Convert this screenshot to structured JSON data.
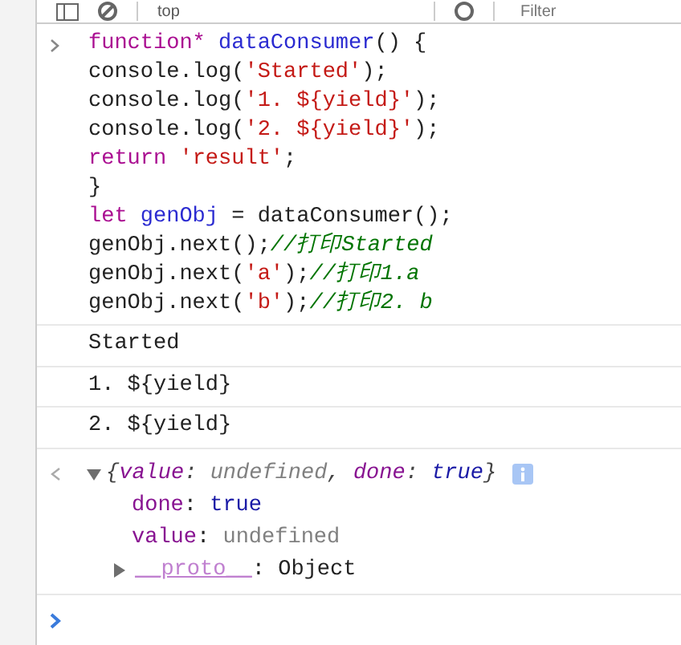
{
  "toolbar": {
    "context": "top",
    "filter": {
      "placeholder": "Filter"
    }
  },
  "input": {
    "lines": [
      [
        {
          "kind": "keyword",
          "text": "function* "
        },
        {
          "kind": "def",
          "text": "dataConsumer"
        },
        {
          "kind": "plain",
          "text": "() {"
        }
      ],
      [
        {
          "kind": "plain",
          "text": "console.log("
        },
        {
          "kind": "string",
          "text": "'Started'"
        },
        {
          "kind": "plain",
          "text": ");"
        }
      ],
      [
        {
          "kind": "plain",
          "text": "console.log("
        },
        {
          "kind": "string",
          "text": "'1. ${yield}'"
        },
        {
          "kind": "plain",
          "text": ");"
        }
      ],
      [
        {
          "kind": "plain",
          "text": "console.log("
        },
        {
          "kind": "string",
          "text": "'2. ${yield}'"
        },
        {
          "kind": "plain",
          "text": ");"
        }
      ],
      [
        {
          "kind": "keyword",
          "text": "return "
        },
        {
          "kind": "string",
          "text": "'result'"
        },
        {
          "kind": "plain",
          "text": ";"
        }
      ],
      [
        {
          "kind": "plain",
          "text": "}"
        }
      ],
      [
        {
          "kind": "keyword",
          "text": "let "
        },
        {
          "kind": "def",
          "text": "genObj"
        },
        {
          "kind": "plain",
          "text": " = dataConsumer();"
        }
      ],
      [
        {
          "kind": "plain",
          "text": "genObj.next();"
        },
        {
          "kind": "comment",
          "text": "//打印Started"
        }
      ],
      [
        {
          "kind": "plain",
          "text": "genObj.next("
        },
        {
          "kind": "string",
          "text": "'a'"
        },
        {
          "kind": "plain",
          "text": ");"
        },
        {
          "kind": "comment",
          "text": "//打印1.a"
        }
      ],
      [
        {
          "kind": "plain",
          "text": "genObj.next("
        },
        {
          "kind": "string",
          "text": "'b'"
        },
        {
          "kind": "plain",
          "text": ");"
        },
        {
          "kind": "comment",
          "text": "//打印2. b"
        }
      ]
    ]
  },
  "logs": [
    "Started",
    "1. ${yield}",
    "2. ${yield}"
  ],
  "result": {
    "expanded": true,
    "summary": [
      {
        "kind": "punct",
        "text": "{"
      },
      {
        "kind": "key",
        "text": "value"
      },
      {
        "kind": "punct",
        "text": ": "
      },
      {
        "kind": "undefined",
        "text": "undefined"
      },
      {
        "kind": "punct",
        "text": ", "
      },
      {
        "kind": "key",
        "text": "done"
      },
      {
        "kind": "punct",
        "text": ": "
      },
      {
        "kind": "boolean",
        "text": "true"
      },
      {
        "kind": "punct",
        "text": "}"
      }
    ],
    "properties": [
      [
        {
          "kind": "key",
          "text": "done"
        },
        {
          "kind": "punct",
          "text": ": "
        },
        {
          "kind": "boolean",
          "text": "true"
        }
      ],
      [
        {
          "kind": "key",
          "text": "value"
        },
        {
          "kind": "punct",
          "text": ": "
        },
        {
          "kind": "undefined",
          "text": "undefined"
        }
      ]
    ],
    "proto": {
      "expanded": false,
      "text": [
        {
          "kind": "proto",
          "text": "__proto__"
        },
        {
          "kind": "punct",
          "text": ": Object"
        }
      ]
    }
  }
}
